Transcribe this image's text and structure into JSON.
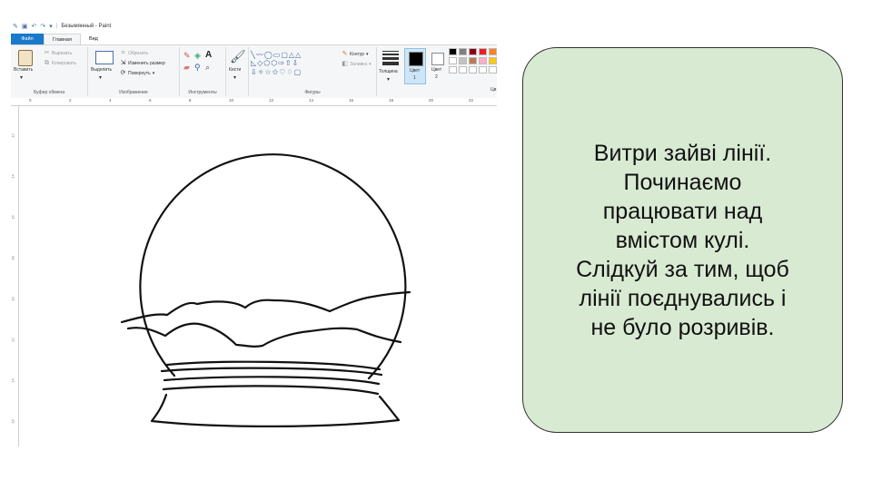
{
  "window": {
    "title": "Безымянный - Paint"
  },
  "tabs": [
    {
      "label": "Файл"
    },
    {
      "label": "Главная"
    },
    {
      "label": "Вид"
    }
  ],
  "ribbon": {
    "clipboard": {
      "paste": "Вставить",
      "cut": "Вырезать",
      "copy": "Копировать",
      "group": "Буфер обмена"
    },
    "image": {
      "select": "Выделить",
      "crop": "Обрезать",
      "resize": "Изменить размер",
      "rotate": "Повернуть",
      "group": "Изображение"
    },
    "tools": {
      "group": "Инструменты"
    },
    "brushes": {
      "label": "Кисти"
    },
    "shapes": {
      "outline": "Контур",
      "fill": "Заливка",
      "group": "Фигуры"
    },
    "size": {
      "label": "Толщина"
    },
    "color1": {
      "label": "Цвет",
      "num": "1"
    },
    "color2": {
      "label": "Цвет",
      "num": "2"
    },
    "palette": [
      "#000000",
      "#7f7f7f",
      "#880015",
      "#ed1c24",
      "#ff7f27",
      "#ffffff",
      "#c3c3c3",
      "#b97a57",
      "#ffaec9",
      "#ffc90e"
    ],
    "colors_group": "Цв"
  },
  "ruler": {
    "h_ticks": [
      "0",
      "2",
      "4",
      "6",
      "8",
      "10",
      "12",
      "14",
      "16",
      "18",
      "20",
      "22"
    ],
    "v_ticks": [
      "12",
      "14",
      "16",
      "18",
      "10",
      "12",
      "14",
      "16"
    ]
  },
  "instruction": {
    "text": "Витри зайві лінії.\nПочинаємо\nпрацювати над\nвмістом кулі.\nСлідкуй за тим, щоб\nлінії поєднувались і\nне було розривів."
  },
  "colors": {
    "card_bg": "#d9ead3",
    "file_tab": "#1979ca"
  }
}
